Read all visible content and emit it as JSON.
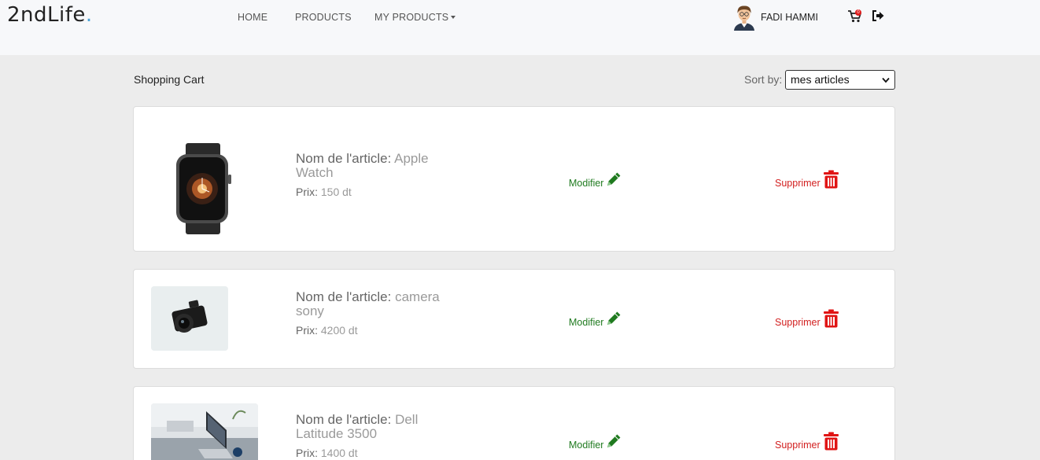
{
  "brand": {
    "name": "2ndLife",
    "dot": "."
  },
  "nav": {
    "home": "HOME",
    "products": "PRODUCTS",
    "my_products": "MY PRODUCTS"
  },
  "user": {
    "name": "FADI HAMMI"
  },
  "cart": {
    "badge": "0"
  },
  "page": {
    "title": "Shopping Cart",
    "sort_label": "Sort by:",
    "sort_value": "mes articles"
  },
  "labels": {
    "name": "Nom de l'article:",
    "price": "Prix:",
    "modify": "Modifier",
    "delete": "Supprimer"
  },
  "items": [
    {
      "name_line1": "Apple",
      "name_line2": "Watch",
      "price": "150 dt"
    },
    {
      "name_line1": "camera",
      "name_line2": "sony",
      "price": "4200 dt"
    },
    {
      "name_line1": "Dell",
      "name_line2": "Latitude 3500",
      "price": "1400 dt"
    }
  ],
  "colors": {
    "modify": "#1f7a1f",
    "delete": "#d21f1f",
    "brand_dot": "#4aa3d8"
  },
  "icons": {
    "modify": "pencil-icon",
    "delete": "trash-icon",
    "cart": "cart-icon",
    "logout": "logout-icon"
  }
}
